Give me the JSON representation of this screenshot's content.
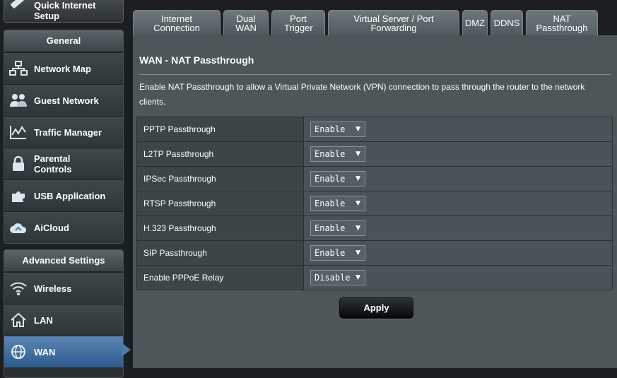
{
  "sidebar": {
    "quick_setup_label": "Quick Internet Setup",
    "general_header": "General",
    "general_items": [
      {
        "label": "Network Map",
        "icon": "network-map-icon"
      },
      {
        "label": "Guest Network",
        "icon": "guest-network-icon"
      },
      {
        "label": "Traffic Manager",
        "icon": "traffic-manager-icon"
      },
      {
        "label": "Parental Controls",
        "icon": "parental-controls-icon"
      },
      {
        "label": "USB Application",
        "icon": "usb-application-icon"
      },
      {
        "label": "AiCloud",
        "icon": "aicloud-icon"
      }
    ],
    "advanced_header": "Advanced Settings",
    "advanced_items": [
      {
        "label": "Wireless",
        "icon": "wireless-icon"
      },
      {
        "label": "LAN",
        "icon": "lan-icon"
      },
      {
        "label": "WAN",
        "icon": "wan-icon",
        "active": true
      }
    ]
  },
  "tabs": [
    {
      "label": "Internet Connection"
    },
    {
      "label": "Dual WAN"
    },
    {
      "label": "Port Trigger"
    },
    {
      "label": "Virtual Server / Port Forwarding"
    },
    {
      "label": "DMZ"
    },
    {
      "label": "DDNS"
    },
    {
      "label": "NAT Passthrough",
      "active": true
    }
  ],
  "panel": {
    "title": "WAN - NAT Passthrough",
    "description": "Enable NAT Passthrough to allow a Virtual Private Network (VPN) connection to pass through the router to the network clients.",
    "rows": [
      {
        "label": "PPTP Passthrough",
        "value": "Enable"
      },
      {
        "label": "L2TP Passthrough",
        "value": "Enable"
      },
      {
        "label": "IPSec Passthrough",
        "value": "Enable"
      },
      {
        "label": "RTSP Passthrough",
        "value": "Enable"
      },
      {
        "label": "H.323 Passthrough",
        "value": "Enable"
      },
      {
        "label": "SIP Passthrough",
        "value": "Enable"
      },
      {
        "label": "Enable PPPoE Relay",
        "value": "Disable"
      }
    ],
    "apply_label": "Apply"
  },
  "colors": {
    "background": "#1b1f21",
    "panel": "#4d5659",
    "active_menu": "#3d6a9c"
  }
}
